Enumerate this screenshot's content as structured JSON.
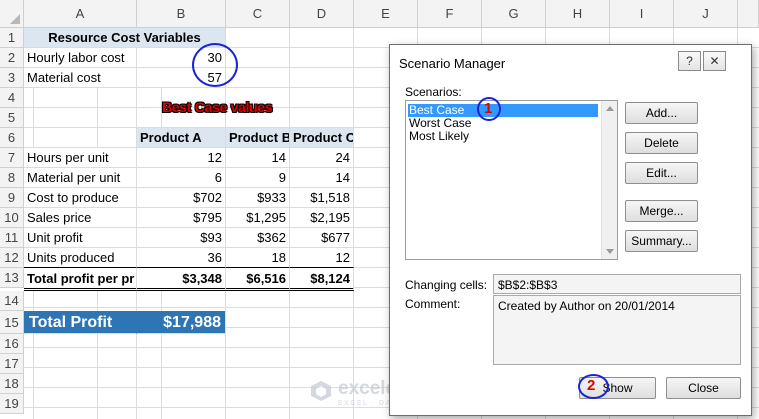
{
  "sheet": {
    "columns": [
      "A",
      "B",
      "C",
      "D",
      "E",
      "F",
      "G",
      "H",
      "I",
      "J"
    ],
    "rows": [
      "1",
      "2",
      "3",
      "4",
      "5",
      "6",
      "7",
      "8",
      "9",
      "10",
      "11",
      "12",
      "13",
      "14",
      "15",
      "16",
      "17",
      "18",
      "19"
    ],
    "resource_header": "Resource Cost Variables",
    "hourly_label": "Hourly labor cost",
    "hourly_value": "30",
    "material_label": "Material cost",
    "material_value": "57",
    "best_case_banner": "Best Case values",
    "product_headers": [
      "Product A",
      "Product B",
      "Product C"
    ],
    "table_rows": [
      {
        "label": "Hours per unit",
        "values": [
          "12",
          "14",
          "24"
        ]
      },
      {
        "label": "Material per unit",
        "values": [
          "6",
          "9",
          "14"
        ]
      },
      {
        "label": "Cost to produce",
        "values": [
          "$702",
          "$933",
          "$1,518"
        ]
      },
      {
        "label": "Sales price",
        "values": [
          "$795",
          "$1,295",
          "$2,195"
        ]
      },
      {
        "label": "Unit profit",
        "values": [
          "$93",
          "$362",
          "$677"
        ]
      },
      {
        "label": "Units produced",
        "values": [
          "36",
          "18",
          "12"
        ]
      },
      {
        "label": "Total profit per pr",
        "values": [
          "$3,348",
          "$6,516",
          "$8,124"
        ]
      }
    ],
    "total_profit_label": "Total Profit",
    "total_profit_value": "$17,988"
  },
  "annotations": {
    "step1": "1",
    "step2": "2"
  },
  "watermark": {
    "name": "exceldemy",
    "tagline": "EXCEL · DATA · BI"
  },
  "dialog": {
    "title": "Scenario Manager",
    "help_button": "?",
    "close_icon": "✕",
    "scenarios_label": "Scenarios:",
    "scenarios": [
      "Best Case",
      "Worst Case",
      "Most Likely"
    ],
    "selected_scenario": "Best Case",
    "buttons": {
      "add": "Add...",
      "delete": "Delete",
      "edit": "Edit...",
      "merge": "Merge...",
      "summary": "Summary...",
      "show": "Show",
      "close": "Close"
    },
    "changing_cells_label": "Changing cells:",
    "changing_cells_value": "$B$2:$B$3",
    "comment_label": "Comment:",
    "comment_value": "Created by Author on 20/01/2014"
  },
  "colors": {
    "total_profit_bg": "#2e75b6",
    "header_band": "#dce6f1",
    "highlight_selection": "#3399ff",
    "annotation_ring": "#1a23d6",
    "annotation_number": "#e00000"
  }
}
